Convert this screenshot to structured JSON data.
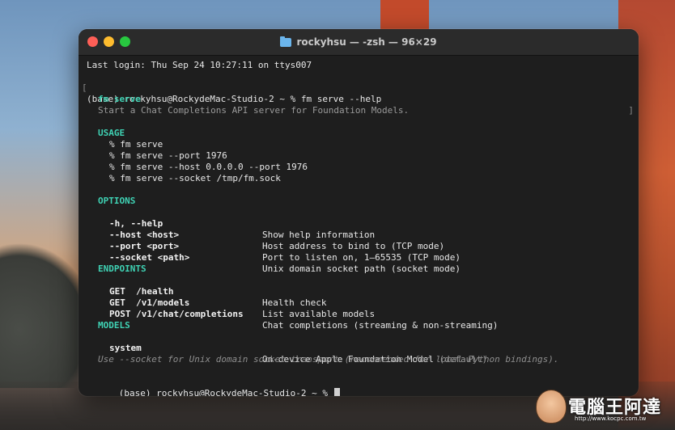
{
  "window": {
    "title": "rockyhsu — -zsh — 96×29"
  },
  "terminal": {
    "last_login": "Last login: Thu Sep 24 10:27:11 on ttys007",
    "prompt_cmd": "(base) rockyhsu@RockydeMac-Studio-2 ~ % fm serve --help",
    "help_title": "fm serve",
    "description": "Start a Chat Completions API server for Foundation Models.",
    "usage_heading": "USAGE",
    "usage": [
      "% fm serve",
      "% fm serve --port 1976",
      "% fm serve --host 0.0.0.0 --port 1976",
      "% fm serve --socket /tmp/fm.sock"
    ],
    "options_heading": "OPTIONS",
    "options": [
      {
        "flag": "-h, --help",
        "desc": "Show help information"
      },
      {
        "flag": "--host <host>",
        "desc": "Host address to bind to (TCP mode)"
      },
      {
        "flag": "--port <port>",
        "desc": "Port to listen on, 1–65535 (TCP mode)"
      },
      {
        "flag": "--socket <path>",
        "desc": "Unix domain socket path (socket mode)"
      }
    ],
    "endpoints_heading": "ENDPOINTS",
    "endpoints": [
      {
        "route": "GET  /health",
        "desc": "Health check"
      },
      {
        "route": "GET  /v1/models",
        "desc": "List available models"
      },
      {
        "route": "POST /v1/chat/completions",
        "desc": "Chat completions (streaming & non-streaming)"
      }
    ],
    "models_heading": "MODELS",
    "model_name": "system",
    "model_desc": "On-device Apple Foundation Model",
    "model_default": "(default)",
    "footer_note": "Use --socket for Unix domain socket transport (recommended for local Python bindings).",
    "final_prompt": "(base) rockyhsu@RockydeMac-Studio-2 ~ % "
  },
  "watermark": {
    "text": "電腦王阿達",
    "url": "http://www.kocpc.com.tw"
  }
}
